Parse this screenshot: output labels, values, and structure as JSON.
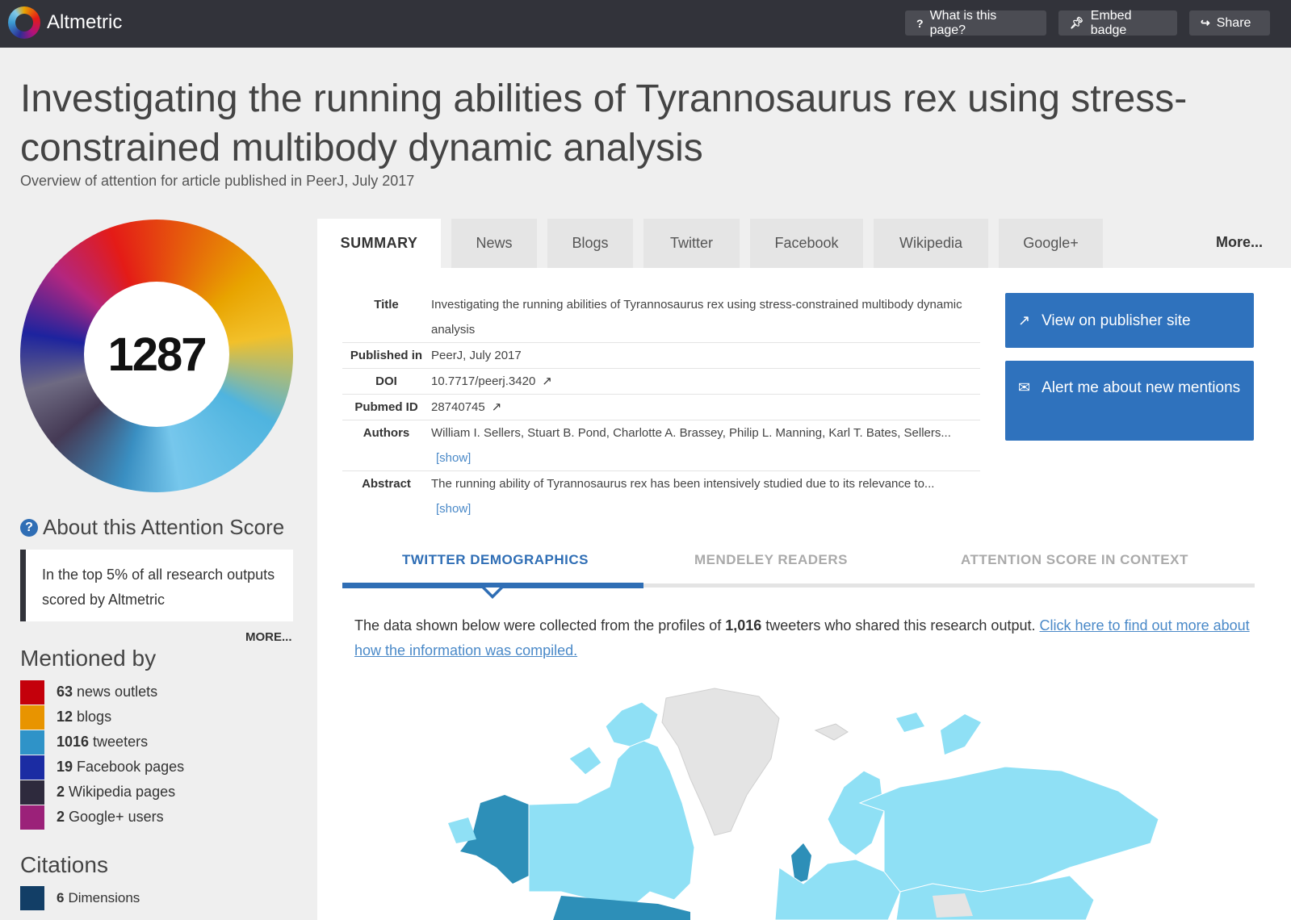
{
  "app": {
    "name": "Altmetric"
  },
  "topbar": {
    "what_label": "What is this page?",
    "embed_label": "Embed badge",
    "share_label": "Share"
  },
  "article": {
    "title": "Investigating the running abilities of Tyrannosaurus rex using stress-constrained multibody dynamic analysis",
    "subtitle": "Overview of attention for article published in PeerJ, July 2017"
  },
  "score": {
    "value": "1287"
  },
  "about": {
    "heading": "About this Attention Score",
    "text": "In the top 5% of all research outputs scored by Altmetric",
    "more": "MORE..."
  },
  "mentioned_by": {
    "heading": "Mentioned by",
    "items": [
      {
        "count": "63",
        "label": "news outlets",
        "color": "#c4000b"
      },
      {
        "count": "12",
        "label": "blogs",
        "color": "#e89400"
      },
      {
        "count": "1016",
        "label": "tweeters",
        "color": "#2f93c8"
      },
      {
        "count": "19",
        "label": "Facebook pages",
        "color": "#1b2ca3"
      },
      {
        "count": "2",
        "label": "Wikipedia pages",
        "color": "#2e2a3d"
      },
      {
        "count": "2",
        "label": "Google+ users",
        "color": "#9b2179"
      }
    ]
  },
  "citations": {
    "heading": "Citations",
    "items": [
      {
        "count": "6",
        "label": "Dimensions",
        "color": "#123e66"
      }
    ]
  },
  "tabs": [
    {
      "label": "SUMMARY",
      "active": true
    },
    {
      "label": "News"
    },
    {
      "label": "Blogs"
    },
    {
      "label": "Twitter"
    },
    {
      "label": "Facebook"
    },
    {
      "label": "Wikipedia"
    },
    {
      "label": "Google+"
    }
  ],
  "tabs_more": "More...",
  "meta": {
    "title_key": "Title",
    "title_val": "Investigating the running abilities of Tyrannosaurus rex using stress-constrained multibody dynamic analysis",
    "published_key": "Published in",
    "published_val": "PeerJ, July 2017",
    "doi_key": "DOI",
    "doi_val": "10.7717/peerj.3420",
    "pubmed_key": "Pubmed ID",
    "pubmed_val": "28740745",
    "authors_key": "Authors",
    "authors_val": "William I. Sellers, Stuart B. Pond, Charlotte A. Brassey, Philip L. Manning, Karl T. Bates, Sellers...",
    "abstract_key": "Abstract",
    "abstract_val": "The running ability of Tyrannosaurus rex has been intensively studied due to its relevance to...",
    "show": "[show]"
  },
  "actions": {
    "publisher": "View on publisher site",
    "alert": "Alert me about new mentions"
  },
  "subtabs": [
    {
      "label": "TWITTER DEMOGRAPHICS",
      "active": true
    },
    {
      "label": "MENDELEY READERS"
    },
    {
      "label": "ATTENTION SCORE IN CONTEXT"
    }
  ],
  "demographics": {
    "text_before": "The data shown below were collected from the profiles of ",
    "count": "1,016",
    "text_after": " tweeters who shared this research output. ",
    "link": "Click here to find out more about how the information was compiled."
  },
  "colors": {
    "accent": "#2f72bd",
    "topbar": "#32333a",
    "map_light": "#8fe0f5",
    "map_dark": "#2d8fb8",
    "map_empty": "#e4e4e4"
  }
}
